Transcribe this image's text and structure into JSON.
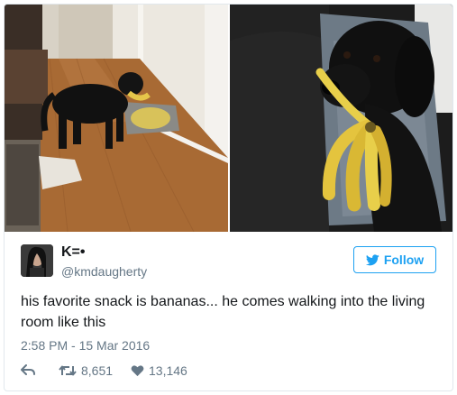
{
  "tweet": {
    "author": {
      "display_name": "K=•",
      "handle": "@kmdaugherty"
    },
    "follow_label": "Follow",
    "text": "his favorite snack is bananas... he comes walking into the living room like this",
    "timestamp": "2:58 PM - 15 Mar 2016",
    "retweets": "8,651",
    "likes": "13,146"
  },
  "media": {
    "images": [
      "dog-carrying-bananas-hallway",
      "dog-holding-bananas-on-couch"
    ]
  },
  "colors": {
    "accent": "#1da1f2",
    "text": "#14171a",
    "muted": "#657786",
    "border": "#e1e8ed"
  },
  "icons": [
    "twitter-bird-icon",
    "reply-icon",
    "retweet-icon",
    "heart-icon"
  ]
}
